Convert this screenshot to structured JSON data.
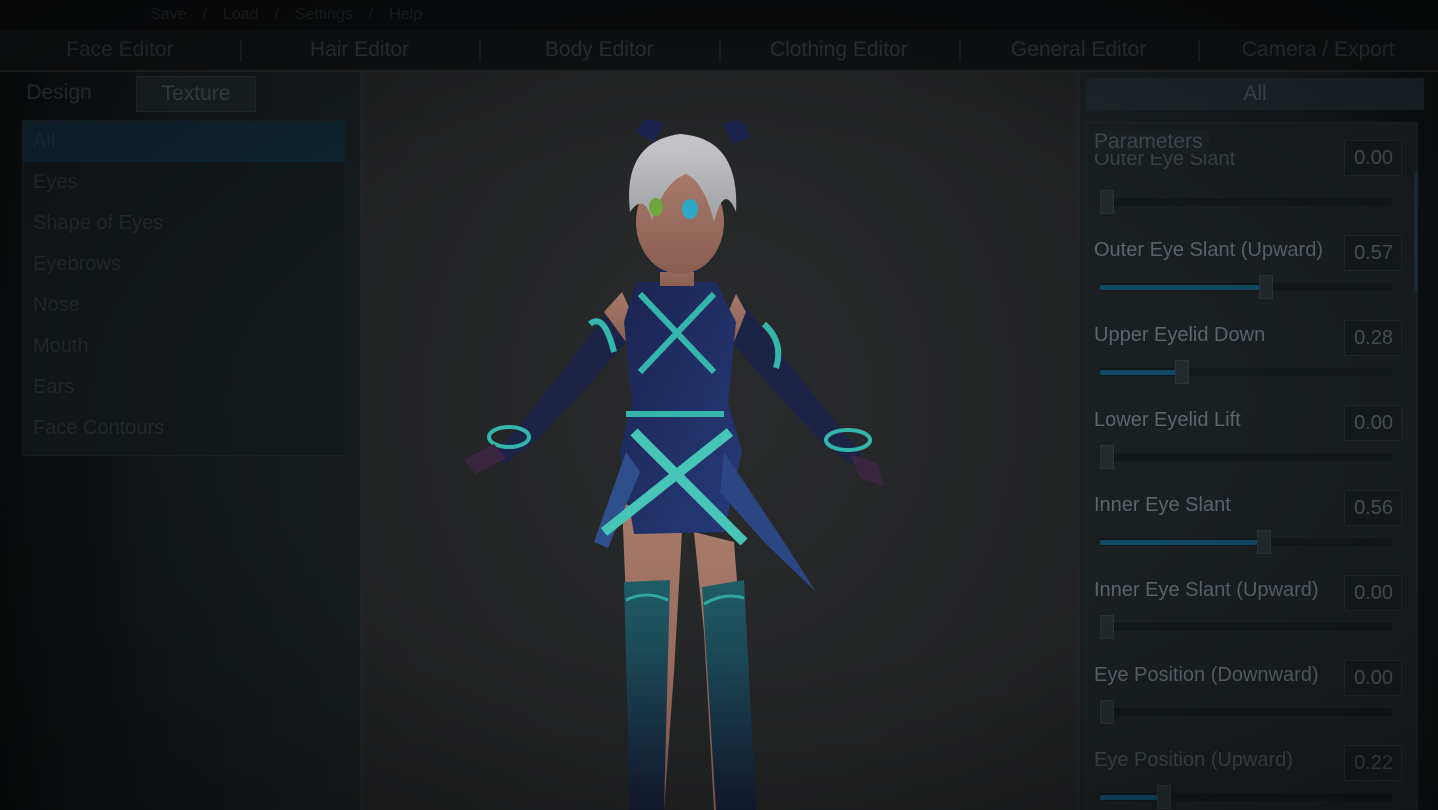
{
  "menu": {
    "items": [
      "Save",
      "Load",
      "Settings",
      "Help"
    ]
  },
  "editor_tabs": [
    "Face Editor",
    "Hair Editor",
    "Body Editor",
    "Clothing Editor",
    "General Editor",
    "Camera / Export"
  ],
  "left_panel": {
    "subtabs": [
      "Design",
      "Texture"
    ],
    "categories": [
      "All",
      "Eyes",
      "Shape of Eyes",
      "Eyebrows",
      "Nose",
      "Mouth",
      "Ears",
      "Face Contours"
    ]
  },
  "right_panel": {
    "filter": "All",
    "section_title": "Parameters",
    "params": [
      {
        "label": "Outer Eye Slant",
        "value": "0.00",
        "level": 0.0
      },
      {
        "label": "Outer Eye Slant (Upward)",
        "value": "0.57",
        "level": 0.57
      },
      {
        "label": "Upper Eyelid Down",
        "value": "0.28",
        "level": 0.28
      },
      {
        "label": "Lower Eyelid Lift",
        "value": "0.00",
        "level": 0.0
      },
      {
        "label": "Inner Eye Slant",
        "value": "0.56",
        "level": 0.56
      },
      {
        "label": "Inner Eye Slant (Upward)",
        "value": "0.00",
        "level": 0.0
      },
      {
        "label": "Eye Position (Downward)",
        "value": "0.00",
        "level": 0.0
      },
      {
        "label": "Eye Position (Upward)",
        "value": "0.22",
        "level": 0.22
      }
    ]
  },
  "colors": {
    "accent": "#0f4a66",
    "outfit_primary": "#1e2a5a",
    "outfit_glow": "#2fa8a0",
    "hair": "#b9b9bb"
  }
}
